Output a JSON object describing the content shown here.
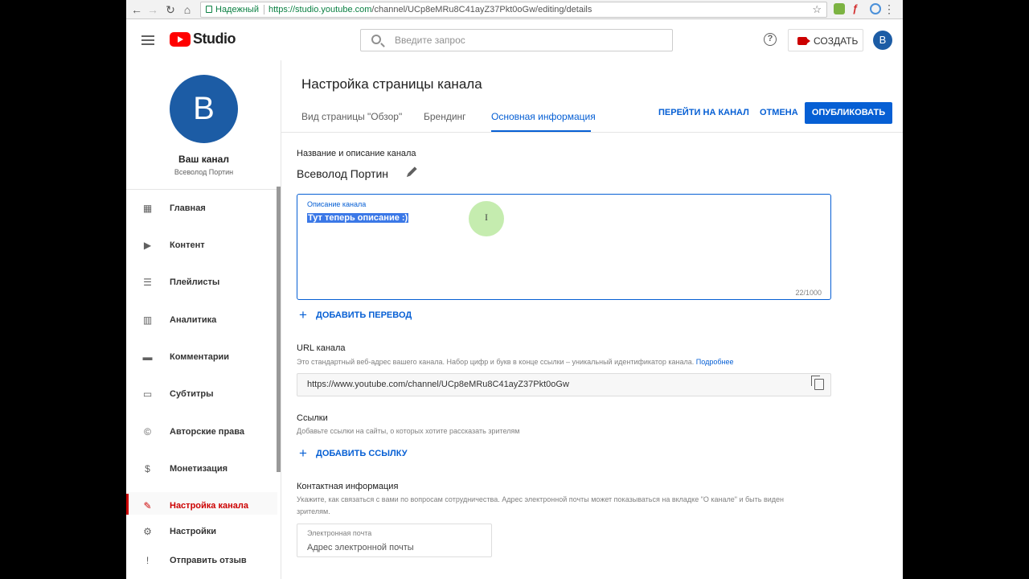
{
  "browser": {
    "secure_label": "Надежный",
    "url_host": "https://studio.youtube.com",
    "url_path": "/channel/UCp8eMRu8C41ayZ37Pkt0oGw/editing/details"
  },
  "header": {
    "logo_text": "Studio",
    "search_placeholder": "Введите запрос",
    "help_label": "?",
    "create_label": "СОЗДАТЬ",
    "avatar_letter": "B"
  },
  "sidebar": {
    "avatar_letter": "B",
    "channel_label": "Ваш канал",
    "owner_name": "Всеволод Портин",
    "items": [
      {
        "label": "Главная",
        "icon": "dashboard-icon"
      },
      {
        "label": "Контент",
        "icon": "video-library-icon"
      },
      {
        "label": "Плейлисты",
        "icon": "playlist-icon"
      },
      {
        "label": "Аналитика",
        "icon": "analytics-icon"
      },
      {
        "label": "Комментарии",
        "icon": "comment-icon"
      },
      {
        "label": "Субтитры",
        "icon": "subtitles-icon"
      },
      {
        "label": "Авторские права",
        "icon": "copyright-icon"
      },
      {
        "label": "Монетизация",
        "icon": "dollar-icon"
      },
      {
        "label": "Настройка канала",
        "icon": "magic-wand-icon"
      }
    ],
    "bottom_items": [
      {
        "label": "Настройки",
        "icon": "gear-icon"
      },
      {
        "label": "Отправить отзыв",
        "icon": "feedback-icon"
      }
    ]
  },
  "main": {
    "title": "Настройка страницы канала",
    "tabs": [
      {
        "label": "Вид страницы \"Обзор\""
      },
      {
        "label": "Брендинг"
      },
      {
        "label": "Основная информация"
      }
    ],
    "go_to_channel": "ПЕРЕЙТИ НА КАНАЛ",
    "cancel": "ОТМЕНА",
    "publish": "ОПУБЛИКОВАТЬ",
    "name_section_label": "Название и описание канала",
    "channel_name": "Всеволод Портин",
    "description": {
      "label": "Описание канала",
      "value": "Тут теперь описание :)",
      "counter": "22/1000"
    },
    "add_translation": "ДОБАВИТЬ ПЕРЕВОД",
    "url_section": {
      "label": "URL канала",
      "hint": "Это стандартный веб-адрес вашего канала. Набор цифр и букв в конце ссылки – уникальный идентификатор канала.",
      "more": "Подробнее",
      "value": "https://www.youtube.com/channel/UCp8eMRu8C41ayZ37Pkt0oGw"
    },
    "links_section": {
      "label": "Ссылки",
      "hint": "Добавьте ссылки на сайты, о которых хотите рассказать зрителям",
      "add_link": "ДОБАВИТЬ ССЫЛКУ"
    },
    "contact_section": {
      "label": "Контактная информация",
      "hint": "Укажите, как связаться с вами по вопросам сотрудничества. Адрес электронной почты может показываться на вкладке \"О канале\" и быть виден зрителям.",
      "email_label": "Электронная почта",
      "email_placeholder": "Адрес электронной почты"
    }
  },
  "colors": {
    "accent_blue": "#065fd4",
    "brand_red": "#ff0000",
    "active_red": "#cc0000",
    "avatar_blue": "#1c5ca5"
  }
}
